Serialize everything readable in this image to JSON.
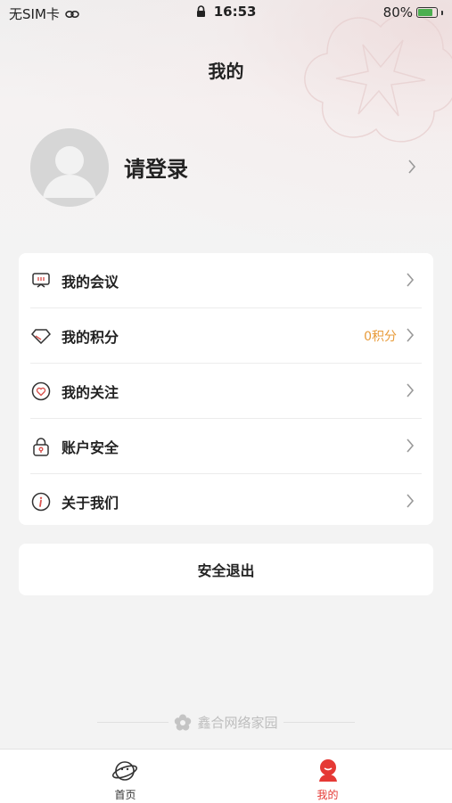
{
  "status_bar": {
    "carrier": "无SIM卡",
    "time": "16:53",
    "battery_percent": "80%",
    "battery_level": 0.8,
    "battery_color": "#4caf50"
  },
  "header": {
    "title": "我的"
  },
  "profile": {
    "login_text": "请登录"
  },
  "menu": {
    "items": [
      {
        "icon": "monitor-icon",
        "label": "我的会议",
        "value": ""
      },
      {
        "icon": "diamond-icon",
        "label": "我的积分",
        "value": "0积分"
      },
      {
        "icon": "heart-icon",
        "label": "我的关注",
        "value": ""
      },
      {
        "icon": "lock-icon",
        "label": "账户安全",
        "value": ""
      },
      {
        "icon": "info-icon",
        "label": "关于我们",
        "value": ""
      }
    ]
  },
  "logout": {
    "label": "安全退出"
  },
  "footer": {
    "brand": "鑫合网络家园"
  },
  "tab_bar": {
    "tabs": [
      {
        "label": "首页",
        "icon": "planet-icon",
        "active": false
      },
      {
        "label": "我的",
        "icon": "user-icon",
        "active": true
      }
    ],
    "active_color": "#e53935",
    "inactive_color": "#333333"
  },
  "colors": {
    "accent": "#e53935",
    "points": "#e89b3a",
    "icon_red": "#d9534f"
  }
}
